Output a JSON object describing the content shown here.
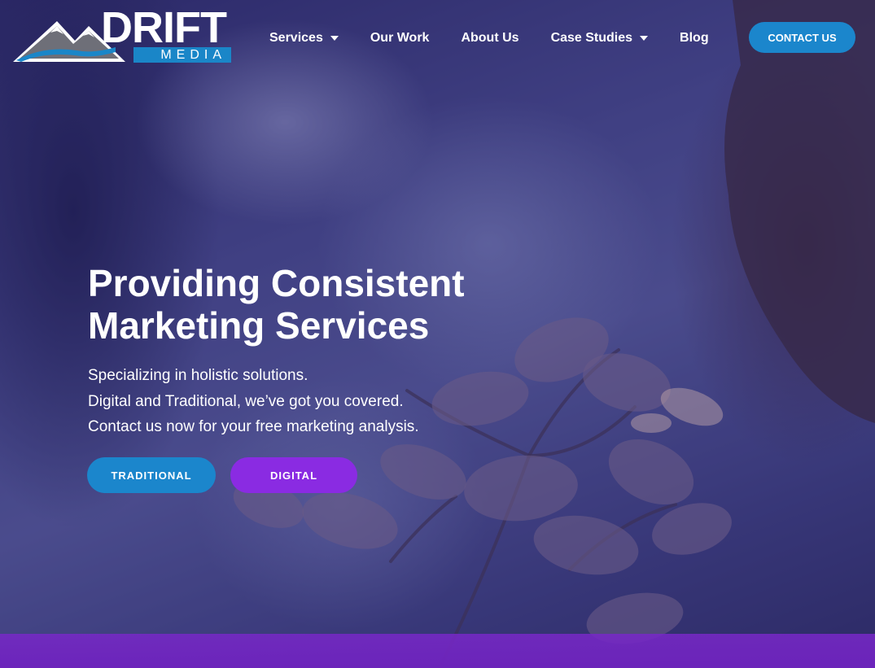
{
  "brand": {
    "name": "DRIFT",
    "tagline": "MEDIA",
    "colors": {
      "blue": "#1b86cc",
      "purple": "#8a2be2",
      "white": "#ffffff"
    }
  },
  "nav": {
    "items": [
      {
        "label": "Services",
        "has_dropdown": true
      },
      {
        "label": "Our Work",
        "has_dropdown": false
      },
      {
        "label": "About Us",
        "has_dropdown": false
      },
      {
        "label": "Case Studies",
        "has_dropdown": true
      },
      {
        "label": "Blog",
        "has_dropdown": false
      }
    ],
    "cta_label": "CONTACT US"
  },
  "hero": {
    "headline_line1": "Providing Consistent",
    "headline_line2": "Marketing Services",
    "sub_lines": [
      "Specializing in holistic solutions.",
      "Digital and Traditional, we’ve got you covered.",
      "Contact us now for your free marketing analysis."
    ],
    "buttons": {
      "traditional": "TRADITIONAL",
      "digital": "DIGITAL"
    }
  },
  "icons": {
    "logo_mountains": "mountain-logo-icon",
    "dropdown": "chevron-down-icon"
  }
}
